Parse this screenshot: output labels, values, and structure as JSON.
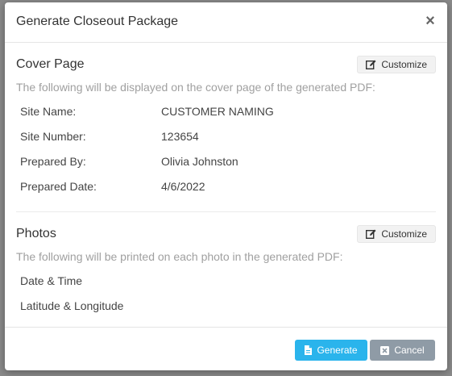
{
  "modal": {
    "title": "Generate Closeout Package",
    "close_symbol": "×"
  },
  "cover_page": {
    "title": "Cover Page",
    "customize_label": "Customize",
    "description": "The following will be displayed on the cover page of the generated PDF:",
    "fields": [
      {
        "label": "Site Name:",
        "value": "CUSTOMER NAMING"
      },
      {
        "label": "Site Number:",
        "value": "123654"
      },
      {
        "label": "Prepared By:",
        "value": "Olivia Johnston"
      },
      {
        "label": "Prepared Date:",
        "value": "4/6/2022"
      }
    ]
  },
  "photos": {
    "title": "Photos",
    "customize_label": "Customize",
    "description": "The following will be printed on each photo in the generated PDF:",
    "fields": [
      {
        "label": "Date & Time"
      },
      {
        "label": "Latitude & Longitude"
      }
    ]
  },
  "footer": {
    "generate_label": "Generate",
    "cancel_label": "Cancel"
  },
  "colors": {
    "generate": "#2ab4ec",
    "cancel": "#8f9ba6"
  },
  "icons": {
    "customize": "edit-icon",
    "generate": "file-icon",
    "cancel": "close-box-icon",
    "close": "close-icon"
  }
}
